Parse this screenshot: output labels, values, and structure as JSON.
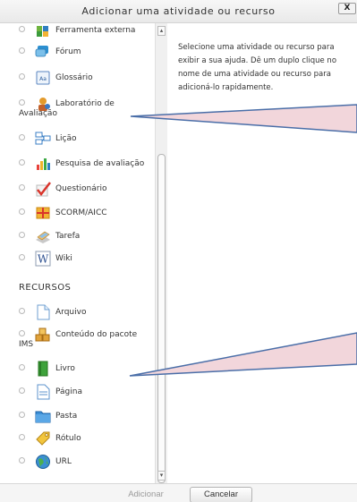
{
  "dialog": {
    "title": "Adicionar uma atividade ou recurso",
    "close_label": "X"
  },
  "activities": [
    {
      "label": "Ferramenta externa",
      "icon": "puzzle-icon"
    },
    {
      "label": "Fórum",
      "icon": "forum-icon"
    },
    {
      "label": "Glossário",
      "icon": "glossary-icon"
    },
    {
      "label": "Laboratório de",
      "label_continued": "Avaliação",
      "icon": "workshop-icon"
    },
    {
      "label": "Lição",
      "icon": "lesson-icon"
    },
    {
      "label": "Pesquisa de avaliação",
      "icon": "survey-icon"
    },
    {
      "label": "Questionário",
      "icon": "quiz-icon"
    },
    {
      "label": "SCORM/AICC",
      "icon": "scorm-icon"
    },
    {
      "label": "Tarefa",
      "icon": "assignment-icon"
    },
    {
      "label": "Wiki",
      "icon": "wiki-icon"
    }
  ],
  "resources_heading": "RECURSOS",
  "resources": [
    {
      "label": "Arquivo",
      "icon": "file-icon"
    },
    {
      "label": "Conteúdo do pacote",
      "label_continued": "IMS",
      "icon": "ims-package-icon"
    },
    {
      "label": "Livro",
      "icon": "book-icon"
    },
    {
      "label": "Página",
      "icon": "page-icon"
    },
    {
      "label": "Pasta",
      "icon": "folder-icon"
    },
    {
      "label": "Rótulo",
      "icon": "label-icon"
    },
    {
      "label": "URL",
      "icon": "url-icon"
    }
  ],
  "help_text": "Selecione uma atividade ou recurso para exibir a sua ajuda. Dê um duplo clique no nome de uma atividade ou recurso para adicioná-lo rapidamente.",
  "buttons": {
    "add": "Adicionar",
    "cancel": "Cancelar"
  },
  "colors": {
    "callout_fill": "#f2d6db",
    "callout_stroke": "#4a6ea8"
  }
}
